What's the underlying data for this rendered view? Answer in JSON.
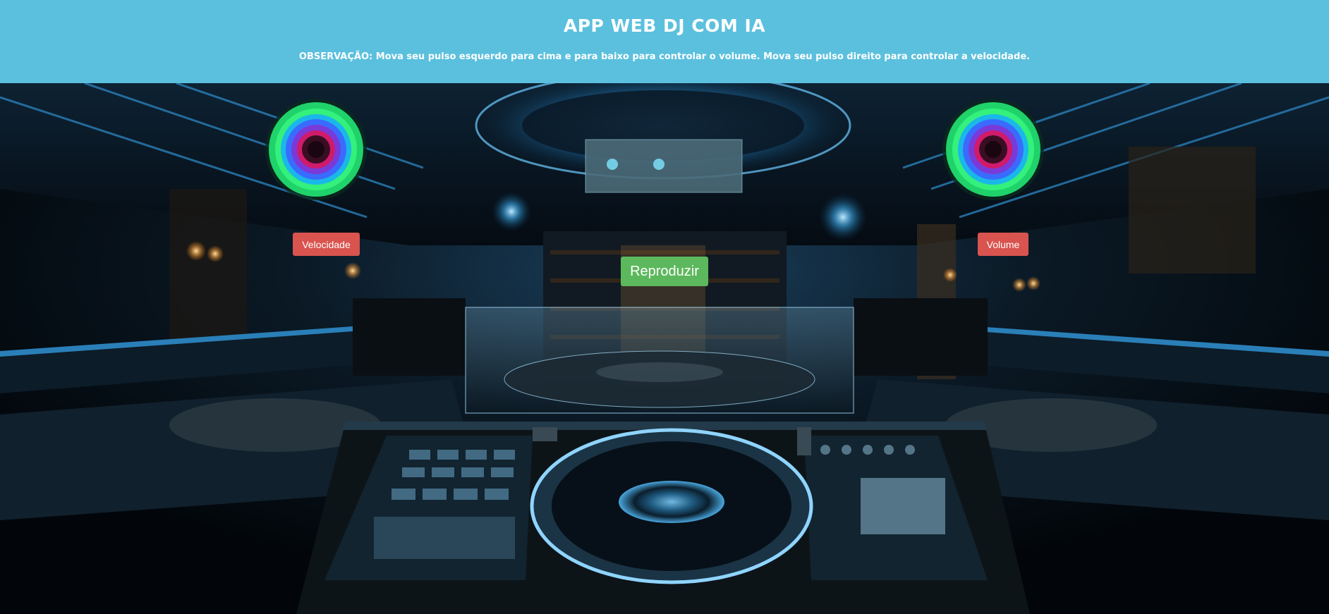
{
  "header": {
    "title": "APP WEB DJ COM IA",
    "note": "OBSERVAÇÃO: Mova seu pulso esquerdo para cima e para baixo para controlar o volume. Mova seu pulso direito para controlar a velocidade."
  },
  "controls": {
    "speed_label": "Velocidade",
    "volume_label": "Volume",
    "play_label": "Reproduzir"
  },
  "colors": {
    "header_bg": "#5bc0de",
    "danger": "#d9534f",
    "success": "#5cb85c"
  },
  "icons": [
    "left-wrist-tracker-icon",
    "right-wrist-tracker-icon"
  ]
}
